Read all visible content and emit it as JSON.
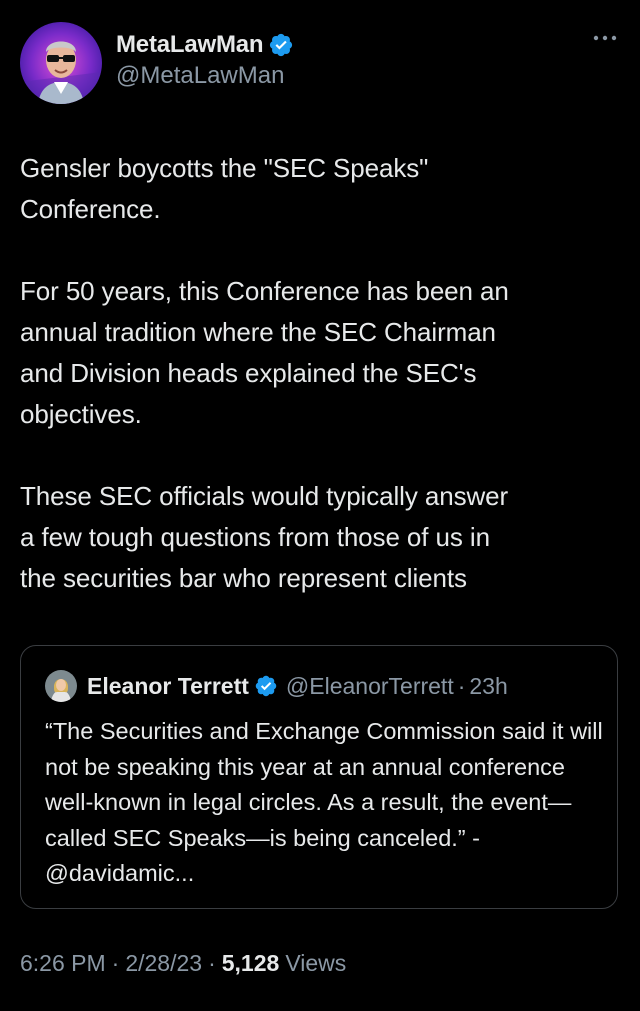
{
  "author": {
    "display_name": "MetaLawMan",
    "handle": "@MetaLawMan",
    "avatar_icon": "avatar-man-sunglasses",
    "verified_icon": "verified-badge-icon",
    "verified_color": "#1d9bf0"
  },
  "more_icon": "more-options-icon",
  "tweet": {
    "text": "Gensler boycotts the \"SEC Speaks\"\nConference.\n\nFor 50 years, this Conference has been an\nannual tradition where the SEC Chairman\nand Division heads explained the SEC's\nobjectives.\n\nThese SEC officials would typically answer\na few tough questions from those of us in\nthe securities bar who represent clients"
  },
  "quote": {
    "display_name": "Eleanor Terrett",
    "handle": "@EleanorTerrett",
    "separator": "·",
    "time": "23h",
    "text": "“The Securities and Exchange Commission said it will not be speaking this year at an annual conference well-known in legal circles. As a result, the event—called SEC Speaks—is being canceled.” - @davidamic..."
  },
  "meta": {
    "time": "6:26 PM",
    "sep1": "·",
    "date": "2/28/23",
    "sep2": "·",
    "views_count": "5,128",
    "views_label": "Views"
  },
  "colors": {
    "background": "#000000",
    "text": "#e7e9ea",
    "secondary": "#8b98a5",
    "border": "#3a3d41"
  }
}
